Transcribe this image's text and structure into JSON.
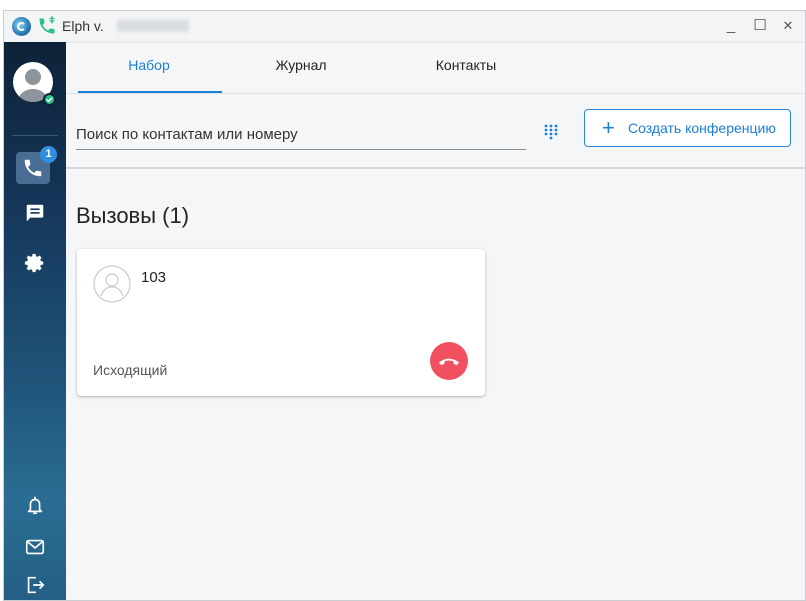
{
  "window": {
    "title": "Elph v.",
    "minimize_glyph": "_",
    "maximize_glyph": "☐",
    "close_glyph": "✕"
  },
  "sidebar": {
    "call_badge": "1",
    "items": [
      {
        "icon": "phone-icon",
        "active": true
      },
      {
        "icon": "chat-icon"
      },
      {
        "icon": "gear-icon"
      },
      {
        "icon": "bell-icon"
      },
      {
        "icon": "mail-icon"
      },
      {
        "icon": "logout-icon"
      }
    ],
    "status_color": "#2bbf86"
  },
  "tabs": [
    {
      "label": "Набор",
      "active": true
    },
    {
      "label": "Журнал"
    },
    {
      "label": "Контакты"
    }
  ],
  "search": {
    "placeholder": "Поиск по контактам или номеру",
    "value": ""
  },
  "conference_button": {
    "plus": "+",
    "label": "Создать конференцию"
  },
  "calls": {
    "title": "Вызовы (1)",
    "items": [
      {
        "number": "103",
        "direction": "Исходящий"
      }
    ]
  },
  "colors": {
    "accent": "#1c7fd6",
    "hangup": "#f0505f"
  }
}
